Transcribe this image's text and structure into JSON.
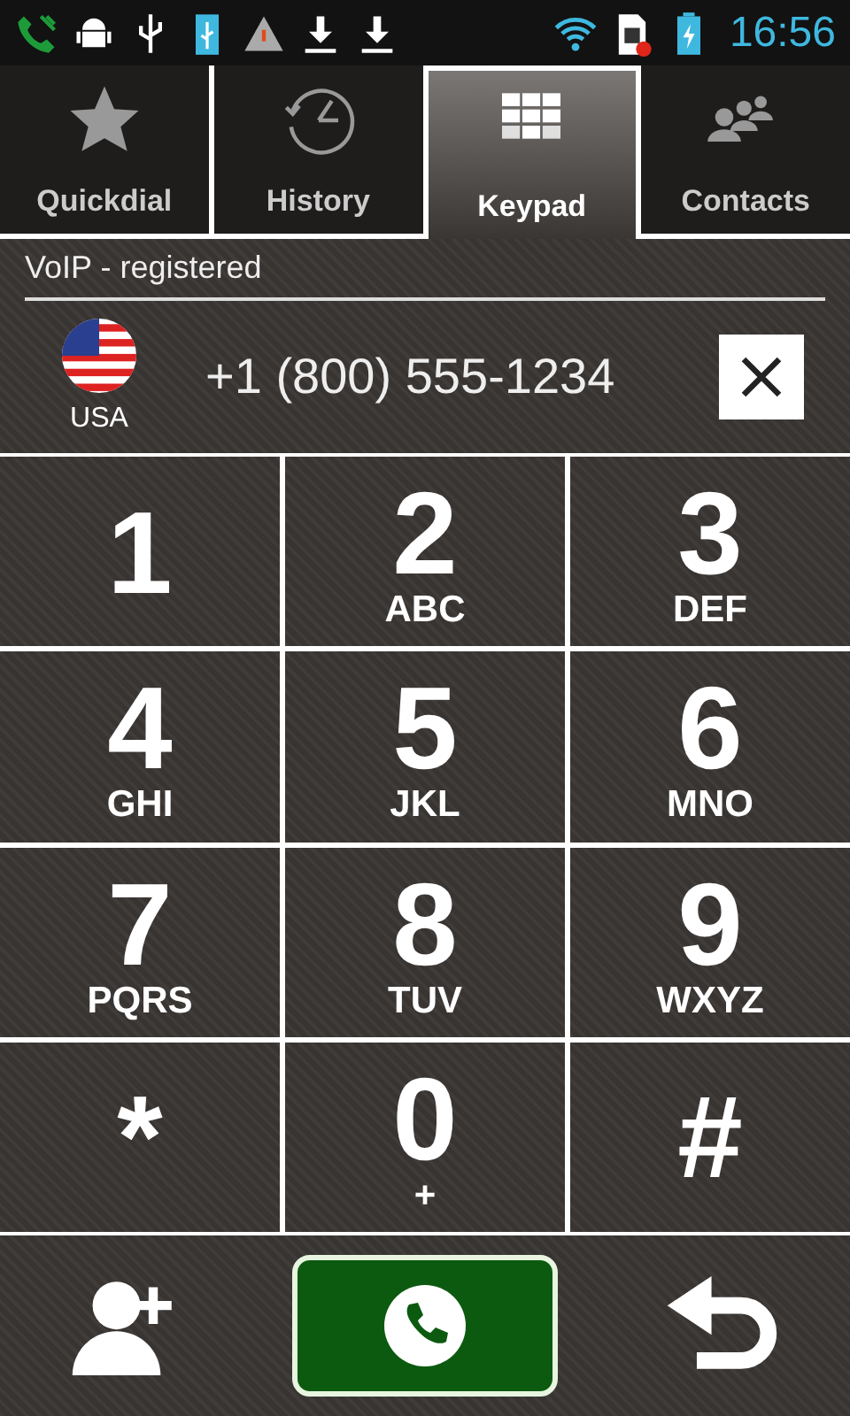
{
  "status_bar": {
    "time": "16:56"
  },
  "tabs": [
    {
      "label": "Quickdial",
      "selected": false
    },
    {
      "label": "History",
      "selected": false
    },
    {
      "label": "Keypad",
      "selected": true
    },
    {
      "label": "Contacts",
      "selected": false
    }
  ],
  "account_status": "VoIP - registered",
  "dial": {
    "country": "USA",
    "number": "+1 (800) 555-1234"
  },
  "keys": [
    {
      "digit": "1"
    },
    {
      "digit": "2",
      "letters": "ABC"
    },
    {
      "digit": "3",
      "letters": "DEF"
    },
    {
      "digit": "4",
      "letters": "GHI"
    },
    {
      "digit": "5",
      "letters": "JKL"
    },
    {
      "digit": "6",
      "letters": "MNO"
    },
    {
      "digit": "7",
      "letters": "PQRS"
    },
    {
      "digit": "8",
      "letters": "TUV"
    },
    {
      "digit": "9",
      "letters": "WXYZ"
    },
    {
      "digit": "*"
    },
    {
      "digit": "0",
      "letters": "+"
    },
    {
      "digit": "#"
    }
  ]
}
